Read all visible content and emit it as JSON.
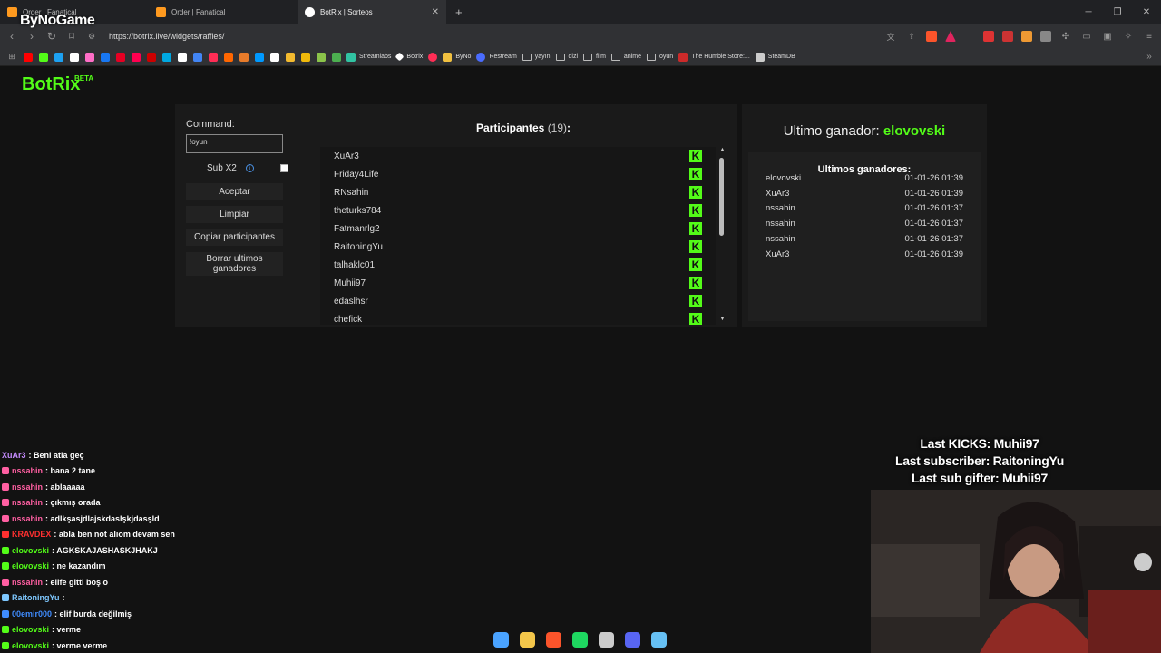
{
  "browser": {
    "tabs": [
      {
        "title": "Order | Fanatical",
        "favicon_color": "#ff9a1f"
      },
      {
        "title": "Order | Fanatical",
        "favicon_color": "#ff9a1f"
      },
      {
        "title": "BotRix | Sorteos",
        "favicon_color": "#ffffff"
      }
    ],
    "new_tab_label": "+",
    "url": "https://botrix.live/widgets/raffles/",
    "bookmarks": [
      {
        "label": "Streamlabs",
        "color": "#31c3a2"
      },
      {
        "label": "Botrix",
        "color": "#ffffff"
      },
      {
        "label": "ByNo",
        "color": "#f0c040"
      },
      {
        "label": "Restream",
        "color": "#4a6cff"
      },
      {
        "label": "yayın",
        "icon": "folder-icon"
      },
      {
        "label": "dizi",
        "icon": "folder-icon"
      },
      {
        "label": "film",
        "icon": "folder-icon"
      },
      {
        "label": "anime",
        "icon": "folder-icon"
      },
      {
        "label": "oyun",
        "icon": "folder-icon"
      },
      {
        "label": "The Humble Store:...",
        "color": "#cc2a2a"
      },
      {
        "label": "SteamDB",
        "color": "#cccccc"
      }
    ],
    "bookmark_icon_colors": [
      "#ff0000",
      "#53fc18",
      "#1da1f2",
      "#ffffff",
      "#ff6ec7",
      "#1877f2",
      "#e60023",
      "#ff0050",
      "#cc0000",
      "#00a8e1",
      "#ffffff",
      "#4285f4",
      "#ff2d55",
      "#ff6600",
      "#e77b2a",
      "#0099ff",
      "#ffffff",
      "#f3ba2f",
      "#f0b90b",
      "#8bc34a",
      "#4caf50"
    ]
  },
  "overlay_logo": "ByNoGame",
  "page": {
    "brand": "BotRix",
    "brand_badge": "BETA",
    "command_label": "Command:",
    "command_value": "!oyun",
    "sub_label": "Sub X2",
    "sub_info_icon": "i",
    "buttons": {
      "accept": "Aceptar",
      "clear": "Limpiar",
      "copy": "Copiar participantes",
      "delete": "Borrar ultimos ganadores"
    },
    "participants_title": "Participantes",
    "participants_count": "(19)",
    "participants_colon": ":",
    "participants": [
      "XuAr3",
      "Friday4Life",
      "RNsahin",
      "theturks784",
      "Fatmanrlg2",
      "RaitoningYu",
      "talhaklc01",
      "Muhii97",
      "edaslhsr",
      "chefick"
    ],
    "kick_badge": "K",
    "last_winner_label": "Ultimo ganador:",
    "last_winner": "elovovski",
    "winners_title": "Ultimos ganadores:",
    "winners": [
      {
        "name": "elovovski",
        "time": "01-01-26 01:39"
      },
      {
        "name": "XuAr3",
        "time": "01-01-26 01:39"
      },
      {
        "name": "nssahin",
        "time": "01-01-26 01:37"
      },
      {
        "name": "nssahin",
        "time": "01-01-26 01:37"
      },
      {
        "name": "nssahin",
        "time": "01-01-26 01:37"
      },
      {
        "name": "XuAr3",
        "time": "01-01-26 01:39"
      }
    ]
  },
  "chat": [
    {
      "user": "XuAr3",
      "color": "#c58cff",
      "text": ": Beni atla geç"
    },
    {
      "user": "nssahin",
      "color": "#ff5fa2",
      "text": ": bana 2 tane"
    },
    {
      "user": "nssahin",
      "color": "#ff5fa2",
      "text": ": ablaaaaa"
    },
    {
      "user": "nssahin",
      "color": "#ff5fa2",
      "text": ": çıkmış orada"
    },
    {
      "user": "nssahin",
      "color": "#ff5fa2",
      "text": ": adlkşasjdlajskdaslşkjdasşld"
    },
    {
      "user": "KRAVDEX",
      "color": "#ff3030",
      "text": ": abla ben not alıom devam sen"
    },
    {
      "user": "elovovski",
      "color": "#53fc18",
      "text": ": AGKSKAJASHASKJHAKJ"
    },
    {
      "user": "elovovski",
      "color": "#53fc18",
      "text": ": ne kazandım"
    },
    {
      "user": "nssahin",
      "color": "#ff5fa2",
      "text": ": elife gitti boş o"
    },
    {
      "user": "RaitoningYu",
      "color": "#7ec8ff",
      "text": ":"
    },
    {
      "user": "00emir000",
      "color": "#3f8cff",
      "text": ": elif burda değilmiş"
    },
    {
      "user": "elovovski",
      "color": "#53fc18",
      "text": ": verme"
    },
    {
      "user": "elovovski",
      "color": "#53fc18",
      "text": ": verme verme"
    }
  ],
  "stream_info": {
    "last_kicks": "Last KICKS: Muhii97",
    "last_subscriber": "Last subscriber: RaitoningYu",
    "last_sub_gifter": "Last sub gifter: Muhii97"
  },
  "taskbar_icons": [
    {
      "name": "windows-start-icon",
      "color": "#4aa3ff"
    },
    {
      "name": "file-explorer-icon",
      "color": "#f3c64a"
    },
    {
      "name": "brave-icon",
      "color": "#fb542b"
    },
    {
      "name": "spotify-icon",
      "color": "#1ed760"
    },
    {
      "name": "obs-icon",
      "color": "#cccccc"
    },
    {
      "name": "discord-icon",
      "color": "#5865f2"
    },
    {
      "name": "steam-icon",
      "color": "#66c0f4"
    }
  ]
}
